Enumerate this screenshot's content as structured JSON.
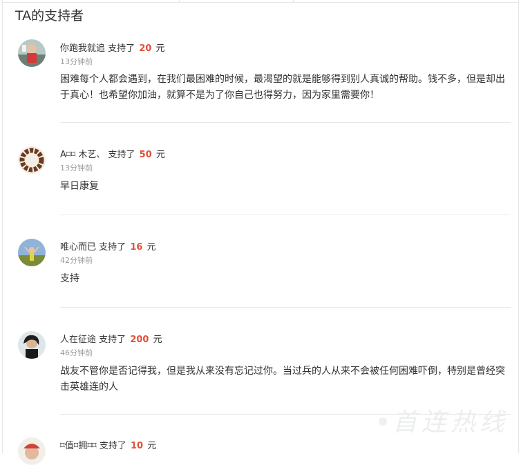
{
  "section": {
    "title": "TA的支持者"
  },
  "supporters": [
    {
      "name": "你跑我就追",
      "action": "支持了",
      "amount": "20",
      "unit": "元",
      "time": "13分钟前",
      "message": "困难每个人都会遇到，在我们最困难的时候，最渴望的就是能够得到别人真诚的帮助。钱不多，但是却出于真心！也希望你加油，就算不是为了你自己也得努力，因为家里需要你！"
    },
    {
      "name": "A⌑⌑ 木艺、",
      "action": "支持了",
      "amount": "50",
      "unit": "元",
      "time": "13分钟前",
      "message": "早日康复"
    },
    {
      "name": "唯心而已",
      "action": "支持了",
      "amount": "16",
      "unit": "元",
      "time": "42分钟前",
      "message": "支持"
    },
    {
      "name": "人在征途",
      "action": "支持了",
      "amount": "200",
      "unit": "元",
      "time": "46分钟前",
      "message": "战友不管你是否记得我，但是我从来没有忘记过你。当过兵的人从来不会被任何困难吓倒，特别是曾经突击英雄连的人"
    },
    {
      "name": "⌑值⌑拥⌑⌑",
      "action": "支持了",
      "amount": "10",
      "unit": "元",
      "time": "",
      "message": ""
    }
  ],
  "watermark": "首连热线",
  "colors": {
    "amount": "#e0513a",
    "divider": "#e8e8e8",
    "time": "#999999"
  },
  "icons": [
    "avatar-1",
    "avatar-2",
    "avatar-3",
    "avatar-4",
    "avatar-5"
  ]
}
